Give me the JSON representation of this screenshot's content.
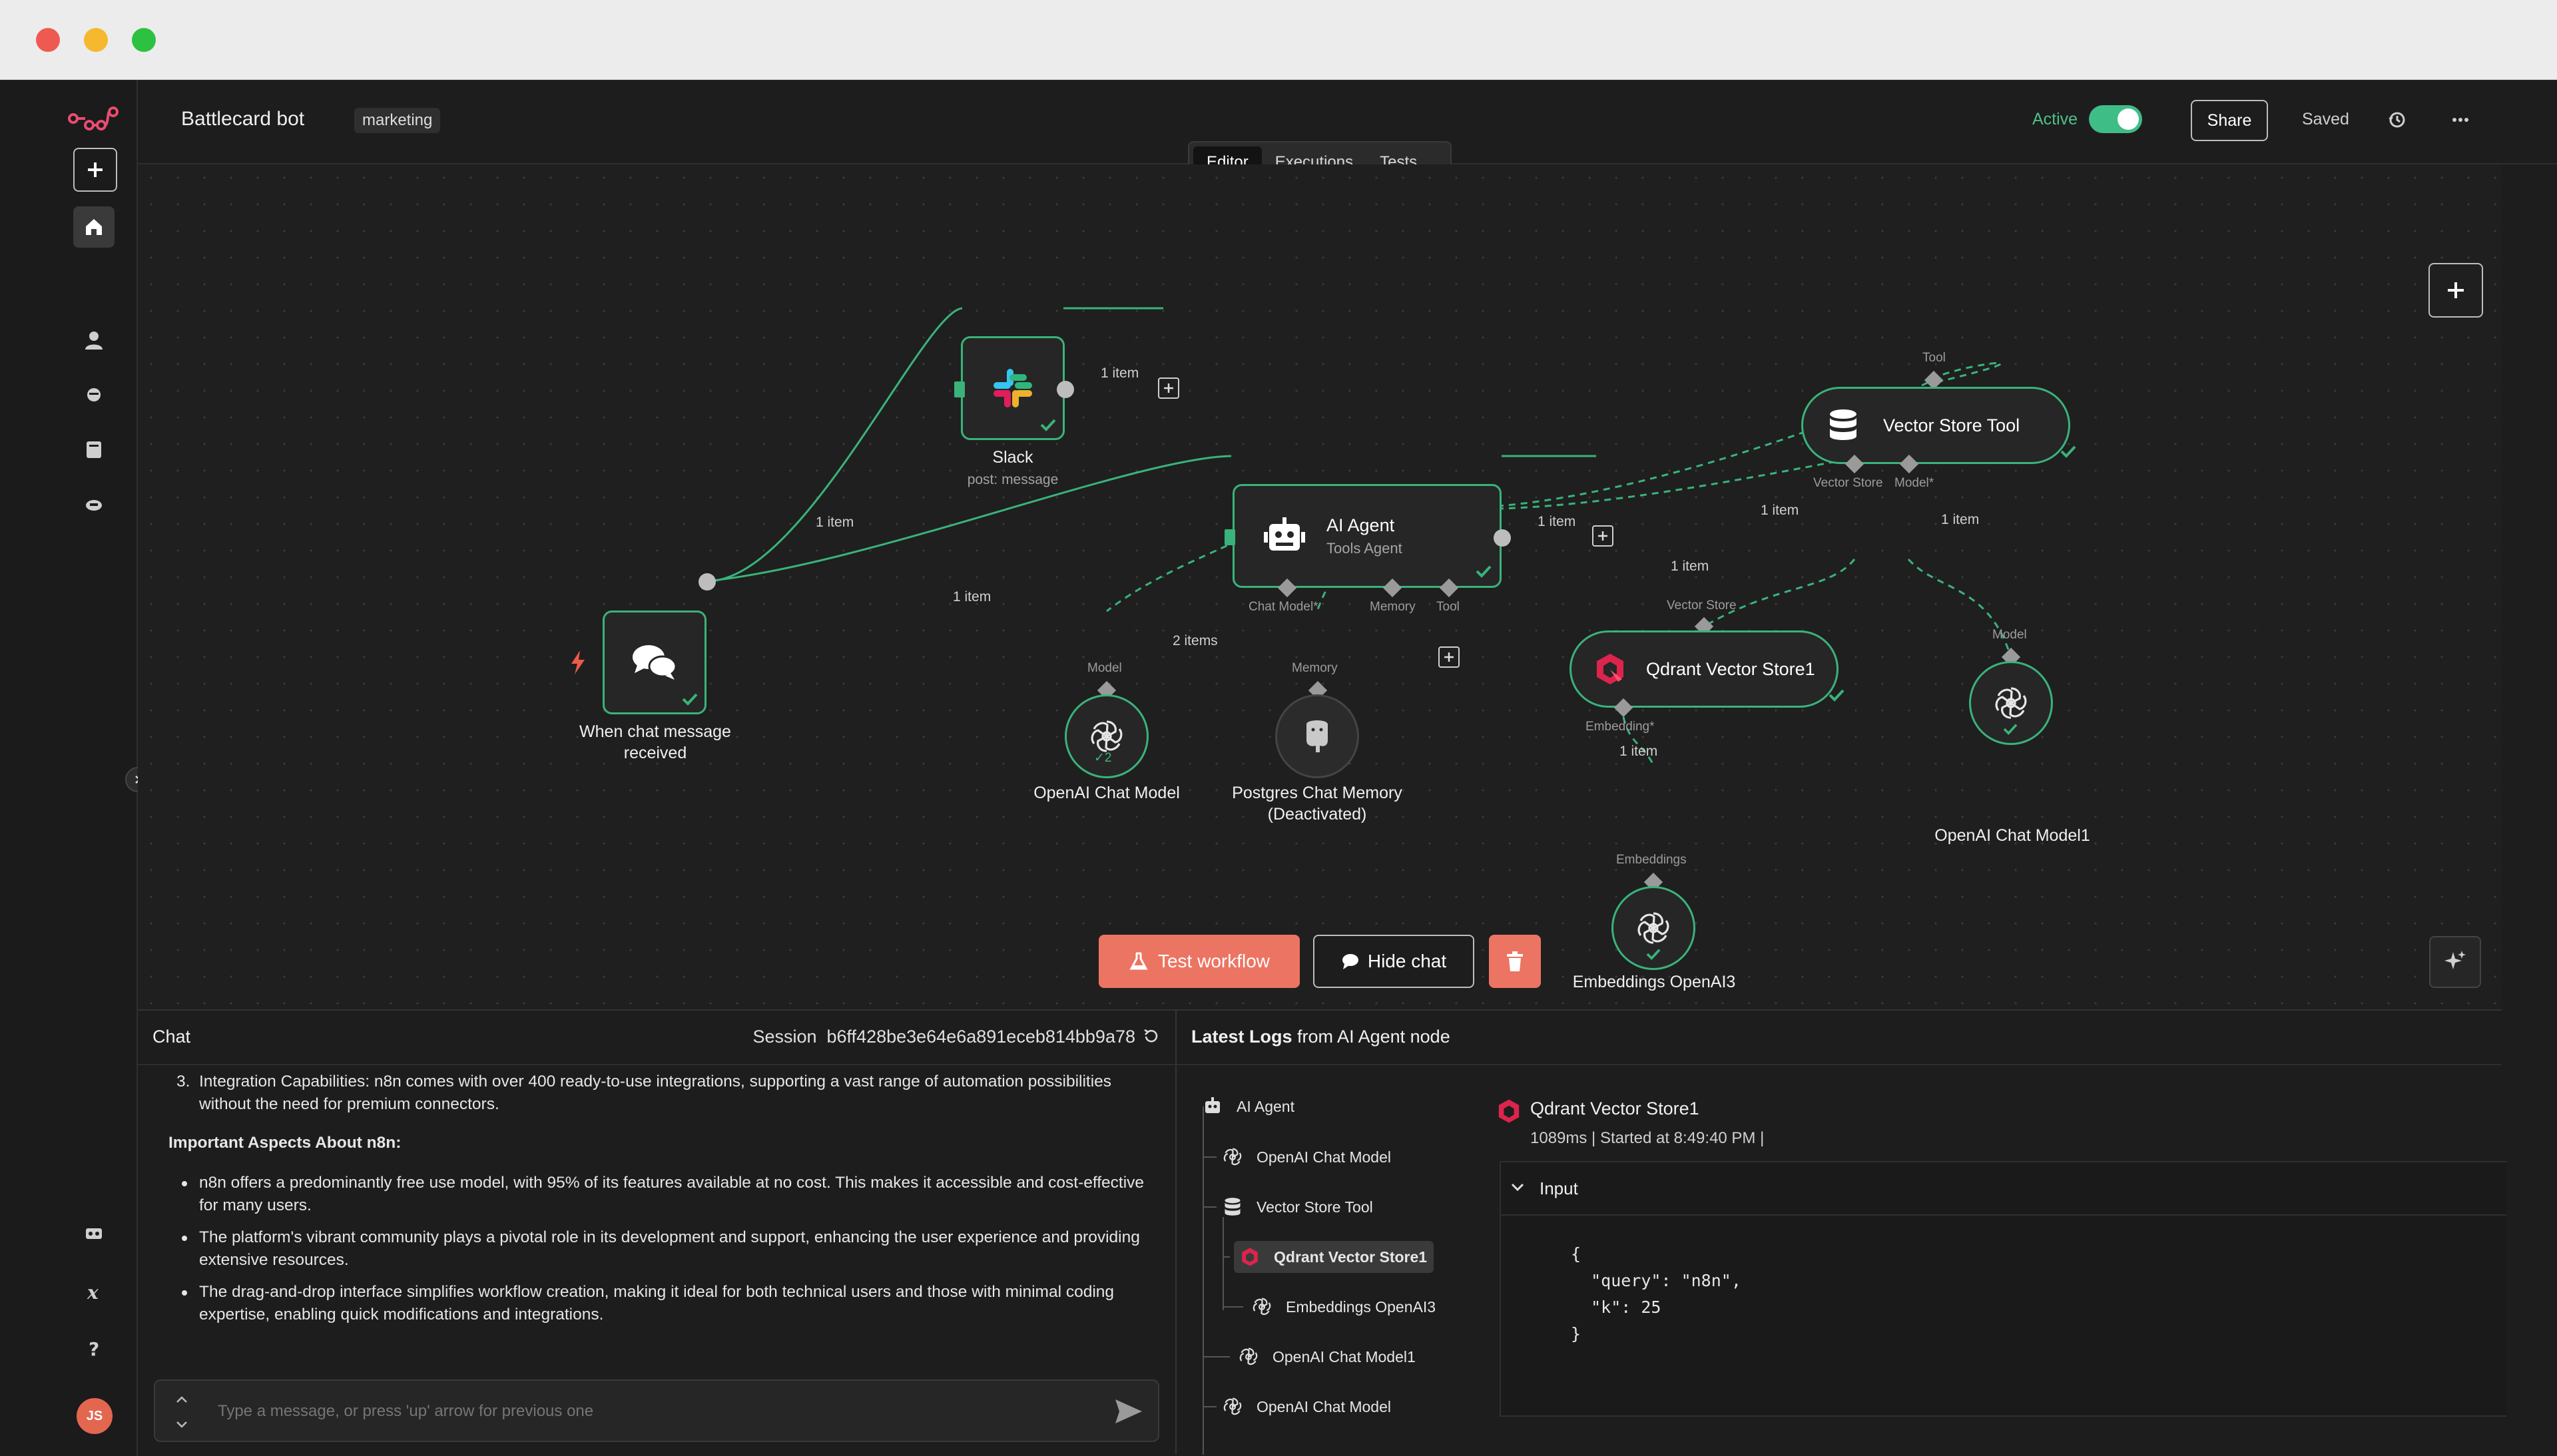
{
  "workflow": {
    "name": "Battlecard bot",
    "tag": "marketing"
  },
  "header": {
    "active_label": "Active",
    "share_label": "Share",
    "saved_label": "Saved"
  },
  "tabs": [
    {
      "label": "Editor",
      "active": true
    },
    {
      "label": "Executions"
    },
    {
      "label": "Tests"
    }
  ],
  "nodes": {
    "trigger": {
      "label": "When chat message received"
    },
    "slack": {
      "label": "Slack",
      "sub": "post: message"
    },
    "agent": {
      "label": "AI Agent",
      "sub": "Tools Agent"
    },
    "openai_chat": {
      "label": "OpenAI Chat Model",
      "count": "2"
    },
    "postgres": {
      "label": "Postgres Chat Memory (Deactivated)"
    },
    "vector_tool": {
      "label": "Vector Store Tool"
    },
    "qdrant": {
      "label": "Qdrant Vector Store1"
    },
    "openai_chat1": {
      "label": "OpenAI Chat Model1"
    },
    "embeddings": {
      "label": "Embeddings OpenAI3"
    }
  },
  "edge_labels": {
    "trigger_slack": "1 item",
    "trigger_agent": "1 item",
    "slack_out": "1 item",
    "agent_out": "1 item",
    "agent_model": "2 items",
    "agent_tool": "1 item",
    "tool_vector": "1 item",
    "tool_model": "1 item",
    "qdrant_embed": "1 item"
  },
  "port_labels": {
    "chat_model": "Chat Model*",
    "memory": "Memory",
    "tool": "Tool",
    "model_in": "Model",
    "memory_in": "Memory",
    "tool_in": "Tool",
    "vector_store": "Vector Store",
    "model": "Model*",
    "vector_store_in": "Vector Store",
    "model_in2": "Model",
    "embedding": "Embedding*",
    "embeddings_in": "Embeddings"
  },
  "actions": {
    "test": "Test workflow",
    "hide_chat": "Hide chat"
  },
  "chat": {
    "title": "Chat",
    "session_label": "Session",
    "session_id": "b6ff428be3e64e6a891eceb814bb9a78",
    "numbered_item": {
      "num": "3.",
      "text": "Integration Capabilities: n8n comes with over 400 ready-to-use integrations, supporting a vast range of automation possibilities without the need for premium connectors."
    },
    "heading": "Important Aspects About n8n:",
    "bullets": [
      "n8n offers a predominantly free use model, with 95% of its features available at no cost. This makes it accessible and cost-effective for many users.",
      "The platform's vibrant community plays a pivotal role in its development and support, enhancing the user experience and providing extensive resources.",
      "The drag-and-drop interface simplifies workflow creation, making it ideal for both technical users and those with minimal coding expertise, enabling quick modifications and integrations."
    ],
    "input_placeholder": "Type a message, or press 'up' arrow for previous one"
  },
  "logs": {
    "title_prefix": "Latest Logs",
    "title_suffix": "from AI Agent node",
    "tree": [
      "AI Agent",
      "OpenAI Chat Model",
      "Vector Store Tool",
      "Qdrant Vector Store1",
      "Embeddings OpenAI3",
      "OpenAI Chat Model1",
      "OpenAI Chat Model"
    ],
    "selected": "Qdrant Vector Store1",
    "detail": {
      "title": "Qdrant Vector Store1",
      "meta": "1089ms | Started at 8:49:40 PM |",
      "input_label": "Input",
      "json": "{\n  \"query\": \"n8n\",\n  \"k\": 25\n}"
    }
  },
  "user": {
    "initials": "JS"
  },
  "colors": {
    "accent": "#ec7462",
    "success": "#3ab37a",
    "active": "#3ebd86"
  }
}
